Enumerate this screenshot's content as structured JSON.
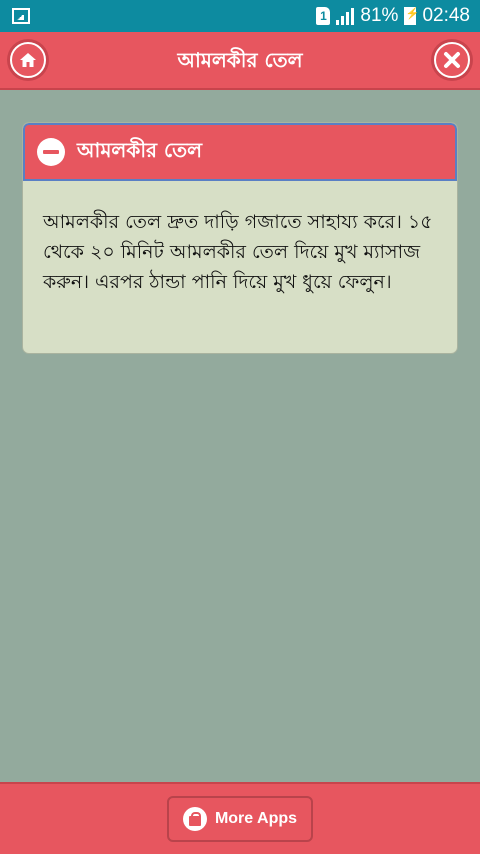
{
  "status_bar": {
    "sim_label": "1",
    "battery_percent": "81%",
    "time": "02:48",
    "icons": [
      "image-notification-icon",
      "sim-icon",
      "signal-icon",
      "battery-charging-icon"
    ]
  },
  "app_bar": {
    "title": "আমলকীর তেল",
    "home_icon": "home-icon",
    "close_icon": "close-icon"
  },
  "card": {
    "title": "আমলকীর তেল",
    "body": "আমলকীর তেল দ্রুত দাড়ি গজাতে সাহায্য করে। ১৫ থেকে ২০ মিনিট আমলকীর তেল দিয়ে মুখ ম্যাসাজ করুন। এরপর ঠান্ডা পানি দিয়ে মুখ ধুয়ে ফেলুন।",
    "icon": "collapse-minus-icon"
  },
  "footer": {
    "more_apps_label": "More Apps",
    "icon": "shopping-bag-icon"
  },
  "colors": {
    "accent": "#e7565f",
    "background": "#93aa9d",
    "status_bar": "#0d8ba0",
    "card_background": "#d7dfc6"
  }
}
